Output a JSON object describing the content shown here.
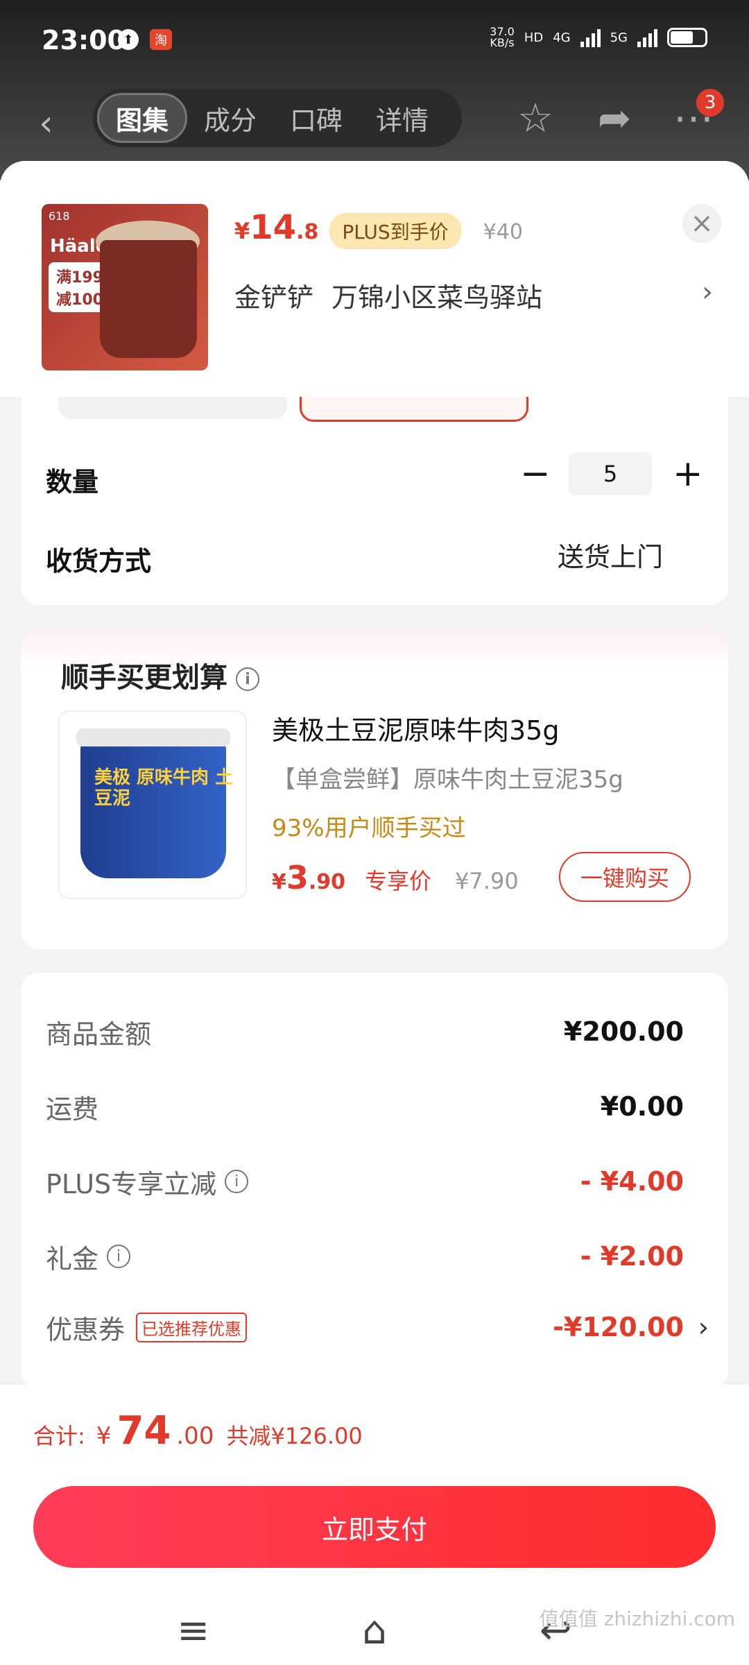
{
  "status": {
    "time": "23:00",
    "speed": "37.0",
    "speed_unit": "KB/s",
    "net1": "4G",
    "net2": "5G",
    "hd": "HD"
  },
  "nav": {
    "tabs": [
      "图集",
      "成分",
      "口碑",
      "详情"
    ],
    "badge": "3"
  },
  "product": {
    "price_symbol": "¥",
    "price_int": "14",
    "price_dec": ".8",
    "plus_tag": "PLUS到手价",
    "original_price": "¥40",
    "user_name": "金铲铲",
    "address": "万锦小区菜鸟驿站",
    "thumb_brand": "Häalo",
    "thumb_promo": "满199 减100",
    "thumb_event": "618"
  },
  "options": {
    "quantity_label": "数量",
    "quantity_value": "5",
    "delivery_label": "收货方式",
    "delivery_value": "送货上门"
  },
  "addon": {
    "title": "顺手买更划算",
    "name": "美极土豆泥原味牛肉35g",
    "subtitle": "【单盒尝鲜】原味牛肉土豆泥35g",
    "rate": "93%用户顺手买过",
    "price_symbol": "¥",
    "price_int": "3",
    "price_dec": ".90",
    "price_label": "专享价",
    "original_price": "¥7.90",
    "buy_button": "一键购买",
    "img_label": "美极 原味牛肉 土豆泥"
  },
  "summary": {
    "rows": [
      {
        "label": "商品金额",
        "value": "¥200.00"
      },
      {
        "label": "运费",
        "value": "¥0.00"
      },
      {
        "label": "PLUS专享立减",
        "value": "- ¥4.00"
      },
      {
        "label": "礼金",
        "value": "- ¥2.00"
      },
      {
        "label": "优惠券",
        "value": "-¥120.00"
      }
    ],
    "coupon_tag": "已选推荐优惠"
  },
  "total": {
    "label": "合计:",
    "symbol": "¥",
    "int": "74",
    "dec": ".00",
    "saved": "共减¥126.00"
  },
  "pay_button": "立即支付",
  "watermark": "值值值 zhizhizhi.com",
  "colors": {
    "accent": "#e23a2a",
    "plus_bg": "#fce7b3",
    "rate": "#c88a16"
  },
  "icons": [
    "back-icon",
    "star-icon",
    "share-icon",
    "more-icon",
    "close-icon",
    "chevron-right-icon",
    "info-icon",
    "menu-icon",
    "home-icon",
    "return-icon"
  ]
}
